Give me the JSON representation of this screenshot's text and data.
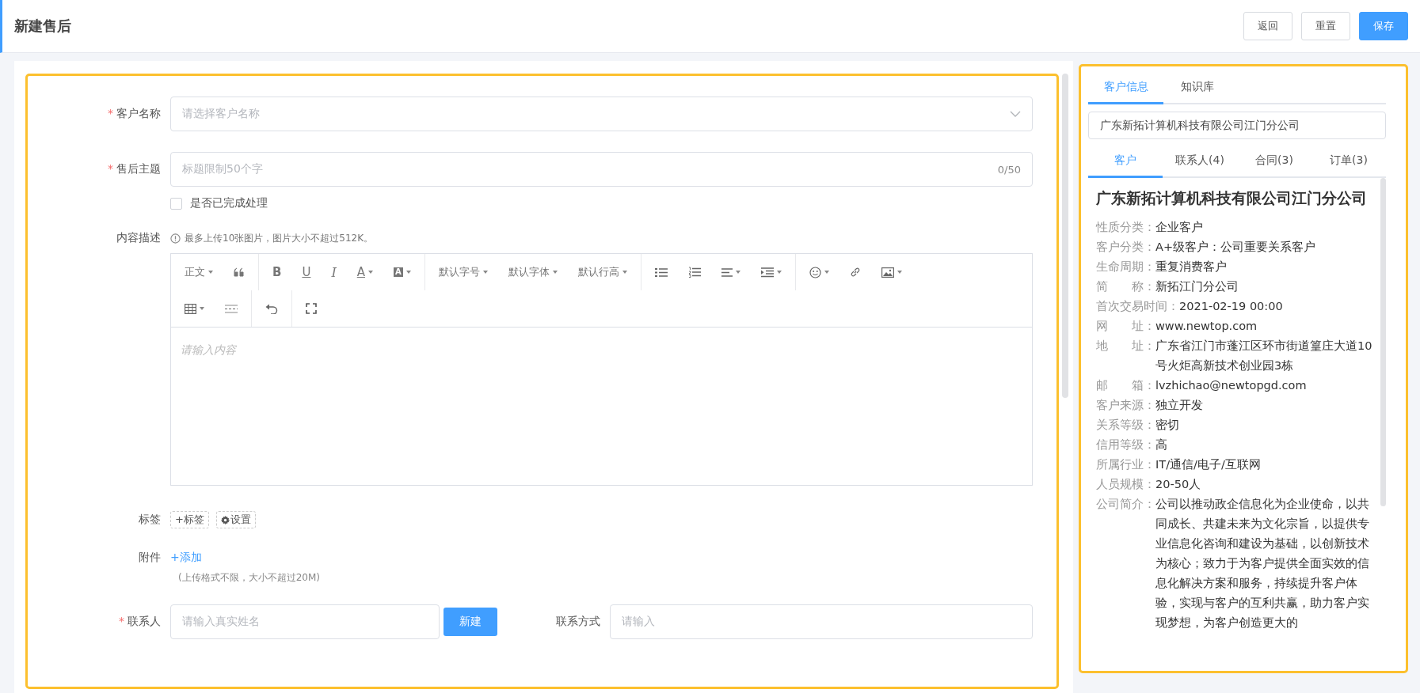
{
  "header": {
    "title": "新建售后",
    "buttons": [
      {
        "label": "返回",
        "primary": false
      },
      {
        "label": "重置",
        "primary": false
      },
      {
        "label": "保存",
        "primary": true
      }
    ]
  },
  "form": {
    "customer_name": {
      "mark": "*",
      "label": "客户名称",
      "placeholder": "请选择客户名称"
    },
    "subject": {
      "mark": "*",
      "label": "售后主题",
      "placeholder": "标题限制50个字",
      "counter": "0/50"
    },
    "completed": {
      "label": "是否已完成处理",
      "checked": false
    },
    "content": {
      "label": "内容描述",
      "hint": "最多上传10张图片，图片大小不超过512K。"
    },
    "editor": {
      "toolbar": {
        "paragraph": "正文",
        "bold": "B",
        "underline": "U",
        "italic": "I",
        "font_color": "A",
        "background_color": "A",
        "font_size": "默认字号",
        "font_family": "默认字体",
        "line_height": "默认行高"
      },
      "placeholder": "请输入内容"
    },
    "tags": {
      "label": "标签",
      "add": "+标签",
      "settings": "设置"
    },
    "attachment": {
      "label": "附件",
      "add": "+添加",
      "note": "(上传格式不限，大小不超过20M)"
    },
    "contact": {
      "mark": "*",
      "label": "联系人",
      "placeholder": "请输入真实姓名",
      "new_button": "新建"
    },
    "contact_method": {
      "label": "联系方式",
      "placeholder": "请输入"
    }
  },
  "side_panel": {
    "tabs": [
      {
        "label": "客户信息",
        "selected": true
      },
      {
        "label": "知识库",
        "selected": false
      }
    ],
    "search": {
      "value": "广东新拓计算机科技有限公司江门分公司"
    },
    "sub_tabs": [
      {
        "label": "客户",
        "selected": true
      },
      {
        "label": "联系人(4)",
        "selected": false
      },
      {
        "label": "合同(3)",
        "selected": false
      },
      {
        "label": "订单(3)",
        "selected": false
      }
    ],
    "customer": {
      "name": "广东新拓计算机科技有限公司江门分公司",
      "fields": [
        {
          "label": "性质分类：",
          "value": "企业客户"
        },
        {
          "label": "客户分类：",
          "value": "A+级客户：公司重要关系客户"
        },
        {
          "label": "生命周期：",
          "value": "重复消费客户"
        },
        {
          "label": "简　　称：",
          "value": "新拓江门分公司"
        },
        {
          "label": "首次交易时间：",
          "value": "2021-02-19 00:00"
        },
        {
          "label": "网　　址：",
          "value": "www.newtop.com"
        },
        {
          "label": "地　　址：",
          "value": "广东省江门市蓬江区环市街道篁庄大道10号火炬高新技术创业园3栋"
        },
        {
          "label": "邮　　箱：",
          "value": "lvzhichao@newtopgd.com"
        },
        {
          "label": "客户来源：",
          "value": "独立开发"
        },
        {
          "label": "关系等级：",
          "value": "密切"
        },
        {
          "label": "信用等级：",
          "value": "高"
        },
        {
          "label": "所属行业：",
          "value": "IT/通信/电子/互联网"
        },
        {
          "label": "人员规模：",
          "value": "20-50人"
        },
        {
          "label": "公司简介：",
          "value": "公司以推动政企信息化为企业使命，以共同成长、共建未来为文化宗旨，以提供专业信息化咨询和建设为基础，以创新技术为核心；致力于为客户提供全面实效的信息化解决方案和服务，持续提升客户体验，实现与客户的互利共赢，助力客户实现梦想，为客户创造更大的"
        }
      ]
    }
  }
}
